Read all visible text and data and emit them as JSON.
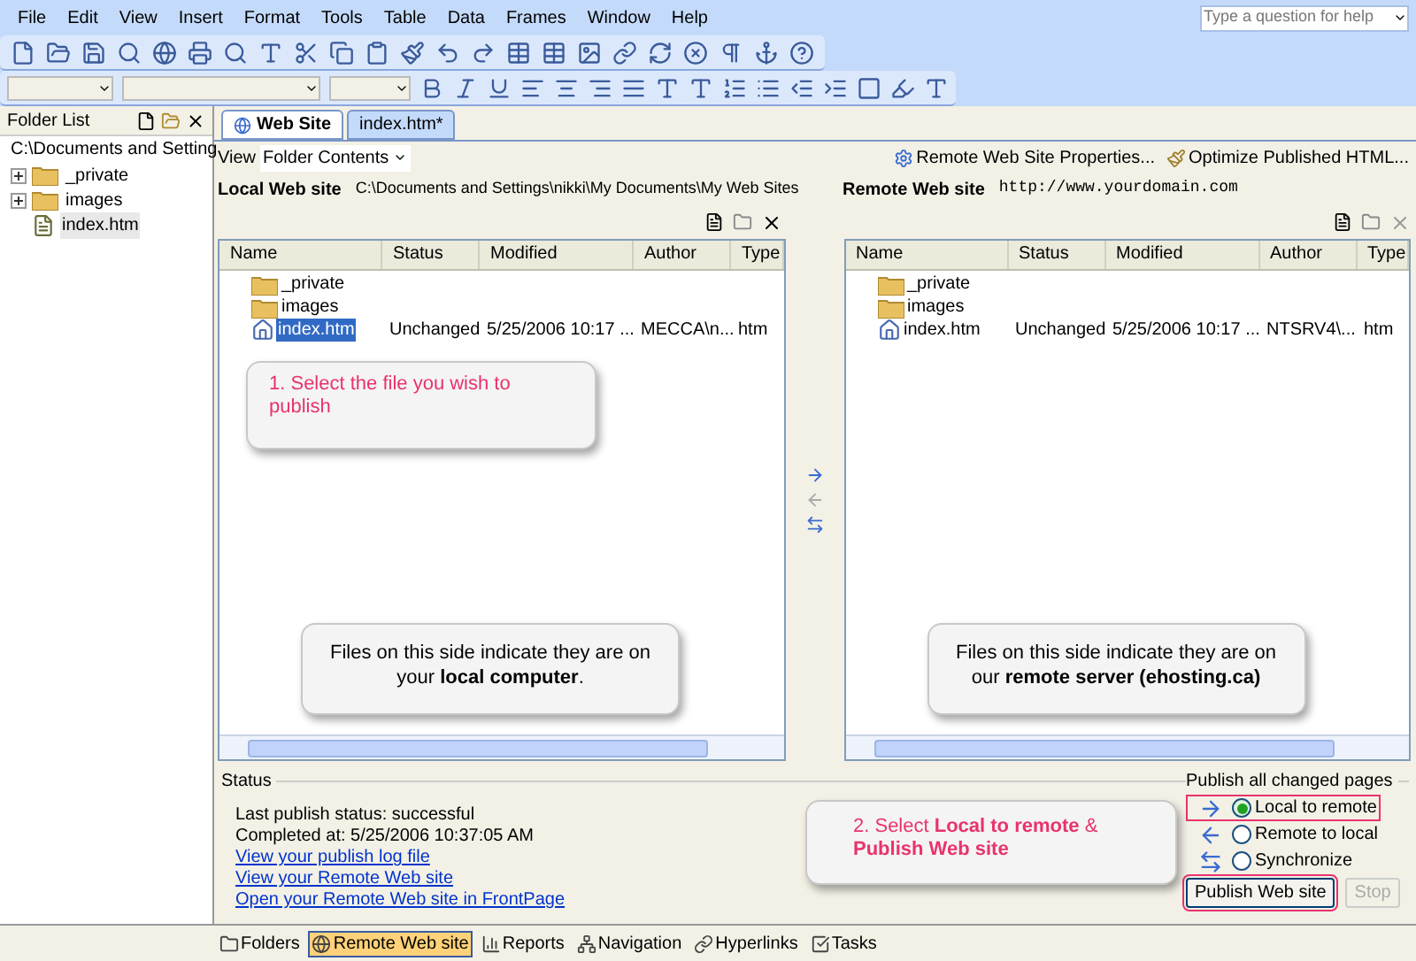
{
  "menu_bar": [
    "File",
    "Edit",
    "View",
    "Insert",
    "Format",
    "Tools",
    "Table",
    "Data",
    "Frames",
    "Window",
    "Help"
  ],
  "help_box": {
    "placeholder": "Type a question for help"
  },
  "folder_list": {
    "title": "Folder List",
    "root": "C:\\Documents and Setting",
    "children": [
      {
        "name": "_private",
        "kind": "folder",
        "selected": false
      },
      {
        "name": "images",
        "kind": "folder",
        "selected": false
      },
      {
        "name": "index.htm",
        "kind": "page",
        "selected": true
      }
    ]
  },
  "tabs": [
    {
      "label": "Web Site",
      "selected": true
    },
    {
      "label": "index.htm*",
      "selected": false
    }
  ],
  "view": {
    "label": "View",
    "value": "Folder Contents"
  },
  "site_actions": [
    "Remote Web Site Properties...",
    "Optimize Published HTML..."
  ],
  "local": {
    "label": "Local Web site",
    "location": "C:\\Documents and Settings\\nikki\\My Documents\\My Web Sites",
    "columns": [
      "Name",
      "Status",
      "Modified",
      "Author",
      "Type"
    ],
    "rows": [
      {
        "name": "_private",
        "kind": "folder",
        "selected": false
      },
      {
        "name": "images",
        "kind": "folder",
        "selected": false
      },
      {
        "name": "index.htm",
        "kind": "home",
        "selected": true,
        "status": "Unchanged",
        "modified": "5/25/2006 10:17 ...",
        "author": "MECCA\\n...",
        "type": "htm"
      }
    ],
    "note": "Files on this side indicate they are on your **local computer**."
  },
  "remote": {
    "label": "Remote Web site",
    "location": "http://www.yourdomain.com",
    "columns": [
      "Name",
      "Status",
      "Modified",
      "Author",
      "Type"
    ],
    "rows": [
      {
        "name": "_private",
        "kind": "folder",
        "selected": false
      },
      {
        "name": "images",
        "kind": "folder",
        "selected": false
      },
      {
        "name": "index.htm",
        "kind": "home",
        "selected": false,
        "status": "Unchanged",
        "modified": "5/25/2006 10:17 ...",
        "author": "NTSRV4\\...",
        "type": "htm"
      }
    ],
    "note": "Files on this side indicate they are on our **remote server (ehosting.ca)**"
  },
  "callouts": [
    "1. Select the file you wish to publish",
    "2. Select **Local to remote** & **Publish Web site**"
  ],
  "status": {
    "title": "Status",
    "lines": [
      "Last publish status: successful",
      "Completed at: 5/25/2006 10:37:05 AM"
    ],
    "links": [
      "View your publish log file",
      "View your Remote Web site",
      "Open your Remote Web site in FrontPage"
    ]
  },
  "publish": {
    "title": "Publish all changed pages",
    "options": [
      {
        "label": "Local to remote",
        "kind": "to-remote",
        "selected": true,
        "highlighted": true
      },
      {
        "label": "Remote to local",
        "kind": "to-local",
        "selected": false,
        "highlighted": false
      },
      {
        "label": "Synchronize",
        "kind": "sync",
        "selected": false,
        "highlighted": false
      }
    ],
    "buttons": [
      {
        "label": "Publish Web site",
        "disabled": false,
        "highlighted": true
      },
      {
        "label": "Stop",
        "disabled": true,
        "highlighted": false
      }
    ]
  },
  "view_tabs": [
    {
      "label": "Folders",
      "kind": "folders",
      "selected": false
    },
    {
      "label": "Remote Web site",
      "kind": "remote",
      "selected": true
    },
    {
      "label": "Reports",
      "kind": "reports",
      "selected": false
    },
    {
      "label": "Navigation",
      "kind": "navigation",
      "selected": false
    },
    {
      "label": "Hyperlinks",
      "kind": "hyperlinks",
      "selected": false
    },
    {
      "label": "Tasks",
      "kind": "tasks",
      "selected": false
    }
  ]
}
